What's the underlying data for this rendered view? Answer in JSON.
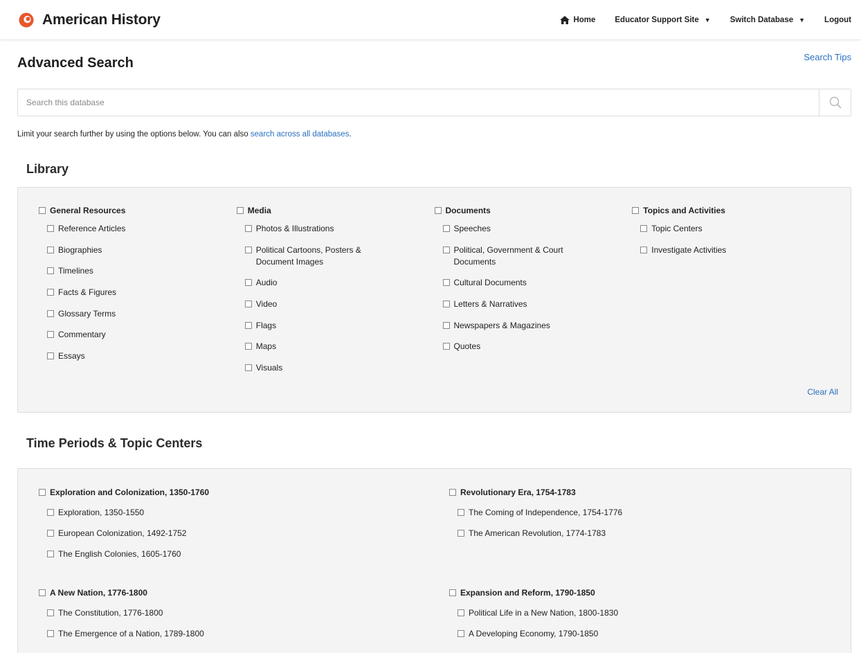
{
  "header": {
    "title": "American History",
    "nav": {
      "home": "Home",
      "educator": "Educator Support Site",
      "switch_db": "Switch Database",
      "logout": "Logout"
    }
  },
  "page": {
    "title": "Advanced Search",
    "search_tips": "Search Tips",
    "search_placeholder": "Search this database",
    "intro_text": "Limit your search further by using the options below. You can also ",
    "intro_link": "search across all databases",
    "intro_end": "."
  },
  "library": {
    "heading": "Library",
    "clear_all": "Clear All",
    "groups": [
      {
        "label": "General Resources",
        "items": [
          "Reference Articles",
          "Biographies",
          "Timelines",
          "Facts & Figures",
          "Glossary Terms",
          "Commentary",
          "Essays"
        ]
      },
      {
        "label": "Media",
        "items": [
          "Photos & Illustrations",
          "Political Cartoons, Posters & Document Images",
          "Audio",
          "Video",
          "Flags",
          "Maps",
          "Visuals"
        ]
      },
      {
        "label": "Documents",
        "items": [
          "Speeches",
          "Political, Government & Court Documents",
          "Cultural Documents",
          "Letters & Narratives",
          "Newspapers & Magazines",
          "Quotes"
        ]
      },
      {
        "label": "Topics and Activities",
        "items": [
          "Topic Centers",
          "Investigate Activities"
        ]
      }
    ]
  },
  "time_periods": {
    "heading": "Time Periods & Topic Centers",
    "groups": [
      {
        "label": "Exploration and Colonization, 1350-1760",
        "items": [
          "Exploration, 1350-1550",
          "European Colonization, 1492-1752",
          "The English Colonies, 1605-1760"
        ]
      },
      {
        "label": "Revolutionary Era, 1754-1783",
        "items": [
          "The Coming of Independence, 1754-1776",
          "The American Revolution, 1774-1783"
        ]
      },
      {
        "label": "A New Nation, 1776-1800",
        "items": [
          "The Constitution, 1776-1800",
          "The Emergence of a Nation, 1789-1800"
        ]
      },
      {
        "label": "Expansion and Reform, 1790-1850",
        "items": [
          "Political Life in a New Nation, 1800-1830",
          "A Developing Economy, 1790-1850"
        ]
      }
    ]
  },
  "colors": {
    "link": "#2a6fc1",
    "brand": "#e8562a",
    "panel_bg": "#f4f4f4"
  },
  "icons": {
    "logo": "swirl-logo",
    "home": "home-icon",
    "search": "search-icon",
    "caret": "caret-down-icon",
    "checkbox": "checkbox-icon"
  }
}
